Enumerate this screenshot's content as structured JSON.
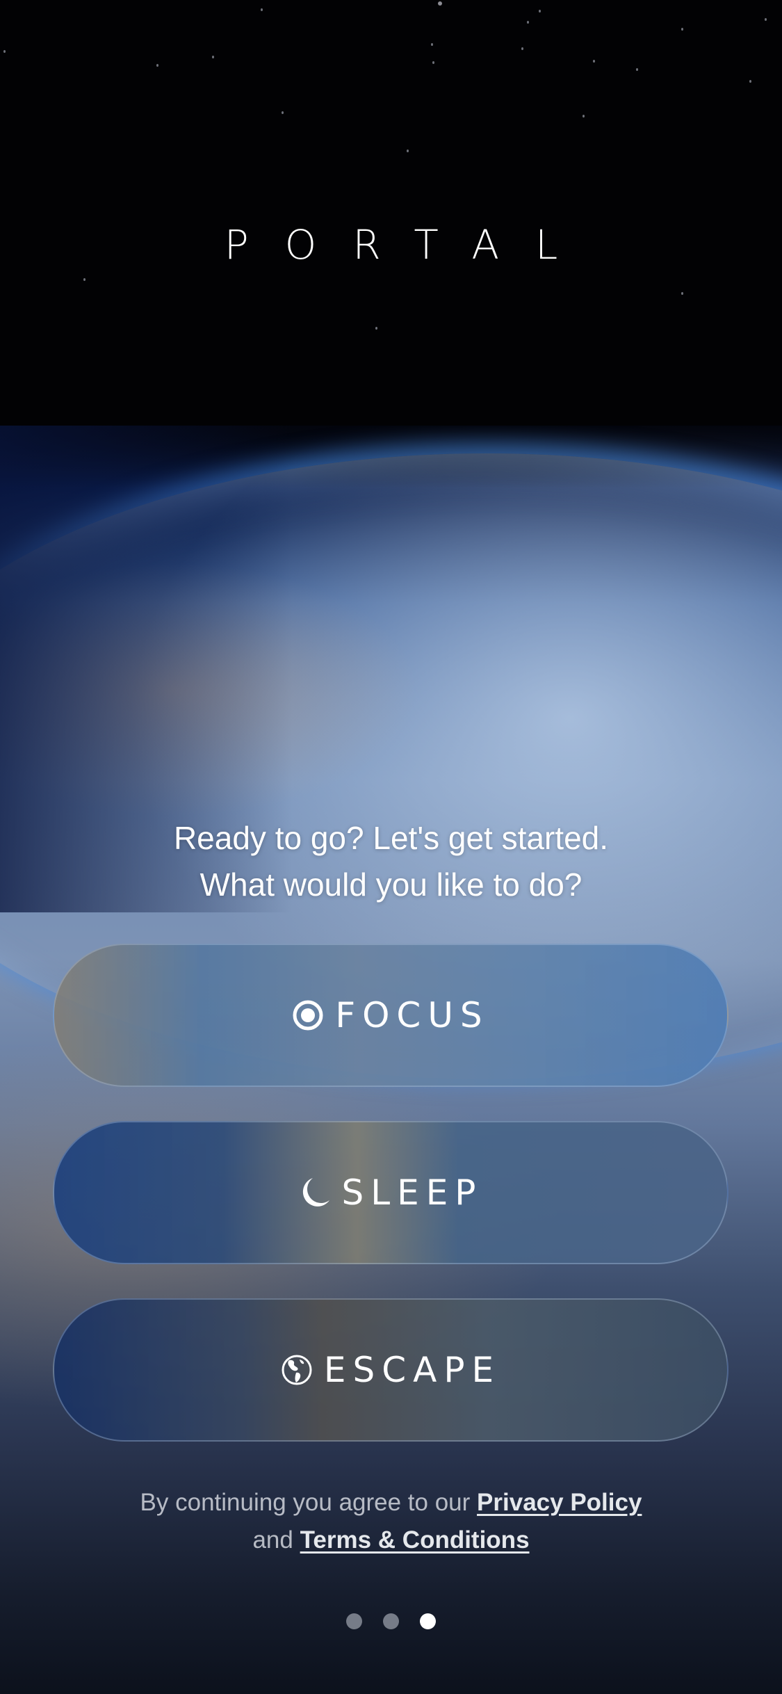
{
  "app": {
    "title": "PORTAL"
  },
  "prompt": {
    "line1": "Ready to go? Let's get started.",
    "line2": "What would you like to do?"
  },
  "buttons": [
    {
      "id": "focus",
      "label": "FOCUS",
      "icon": "focus-target-icon"
    },
    {
      "id": "sleep",
      "label": "SLEEP",
      "icon": "moon-icon"
    },
    {
      "id": "escape",
      "label": "ESCAPE",
      "icon": "globe-icon"
    }
  ],
  "legal": {
    "prefix": "By continuing you agree to our",
    "privacy_link": "Privacy Policy",
    "conjunction": "and",
    "terms_link": "Terms & Conditions"
  },
  "pagination": {
    "total": 3,
    "current": 3
  }
}
